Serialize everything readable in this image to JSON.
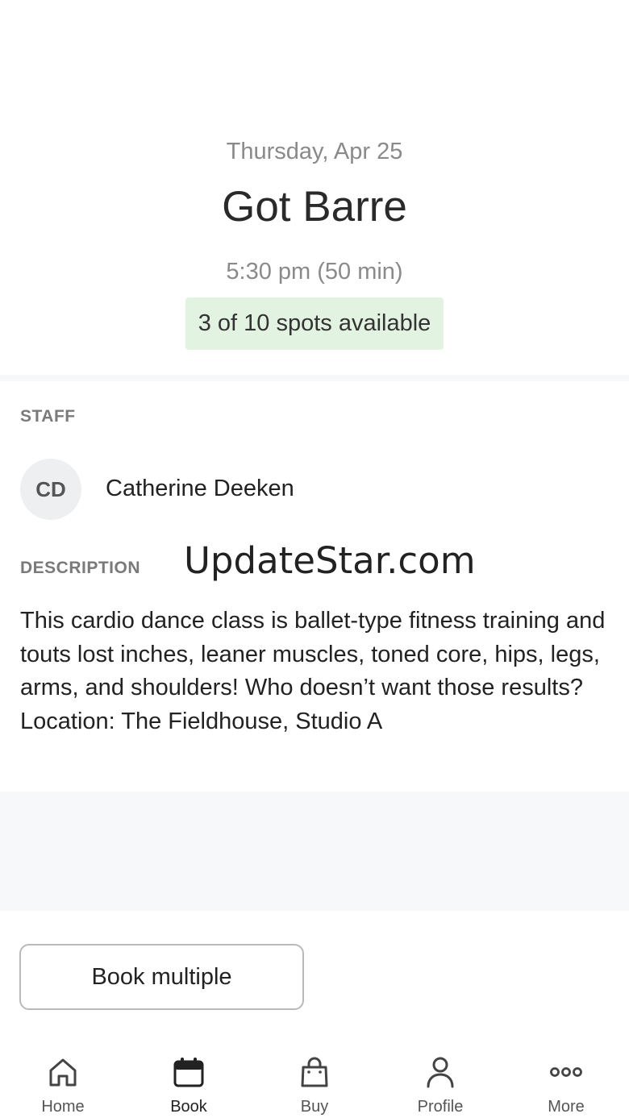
{
  "class": {
    "date": "Thursday, Apr 25",
    "title": "Got Barre",
    "time": "5:30 pm (50 min)",
    "spots": "3 of 10 spots available"
  },
  "staff": {
    "section_label": "STAFF",
    "initials": "CD",
    "name": "Catherine Deeken"
  },
  "description": {
    "section_label": "DESCRIPTION",
    "text": "This cardio dance class is ballet-type fitness training and touts lost inches, leaner muscles, toned core, hips, legs, arms, and shoulders! Who doesn’t want those results?   Location: The Fieldhouse, Studio A"
  },
  "watermark": "UpdateStar.com",
  "actions": {
    "book_multiple_label": "Book multiple"
  },
  "tabbar": {
    "active": "Book",
    "tabs": [
      {
        "label": "Home",
        "icon": "home-icon"
      },
      {
        "label": "Book",
        "icon": "calendar-icon"
      },
      {
        "label": "Buy",
        "icon": "shopping-bag-icon"
      },
      {
        "label": "Profile",
        "icon": "person-icon"
      },
      {
        "label": "More",
        "icon": "more-dots-icon"
      }
    ]
  },
  "colors": {
    "spots_badge_bg": "#e3f3e1",
    "muted_text": "#8a8a8a",
    "section_band": "#f6f8fa"
  }
}
